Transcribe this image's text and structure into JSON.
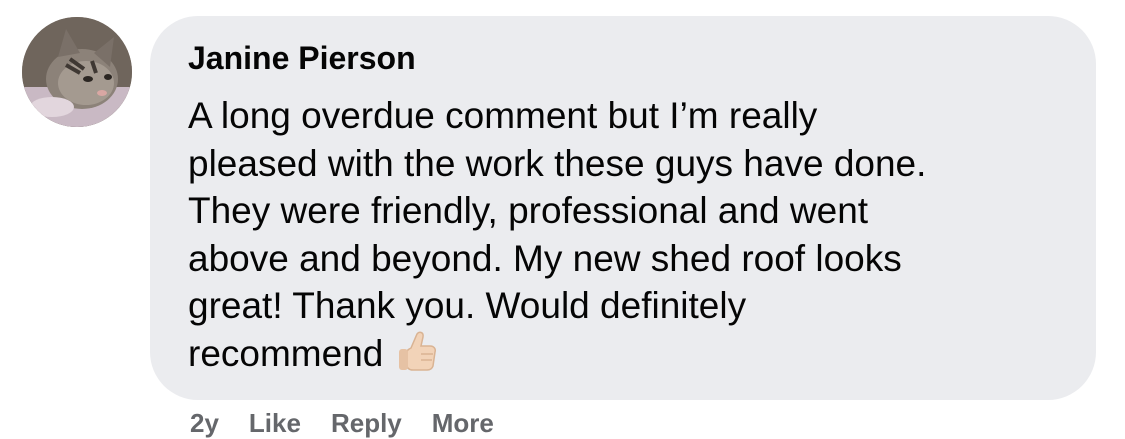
{
  "comment": {
    "author": "Janine Pierson",
    "lines": [
      "A long overdue comment but I’m really",
      "pleased with the work these guys have done.",
      "They were friendly, professional and went",
      "above and beyond. My new shed roof looks",
      "great! Thank you. Would definitely",
      "recommend"
    ],
    "emoji": "thumbs-up-icon",
    "avatar_icon": "cat-avatar-icon",
    "actions": {
      "time": "2y",
      "like": "Like",
      "reply": "Reply",
      "more": "More"
    }
  },
  "colors": {
    "bubble_bg": "#ebecef",
    "text": "#050505",
    "meta": "#65676b"
  }
}
